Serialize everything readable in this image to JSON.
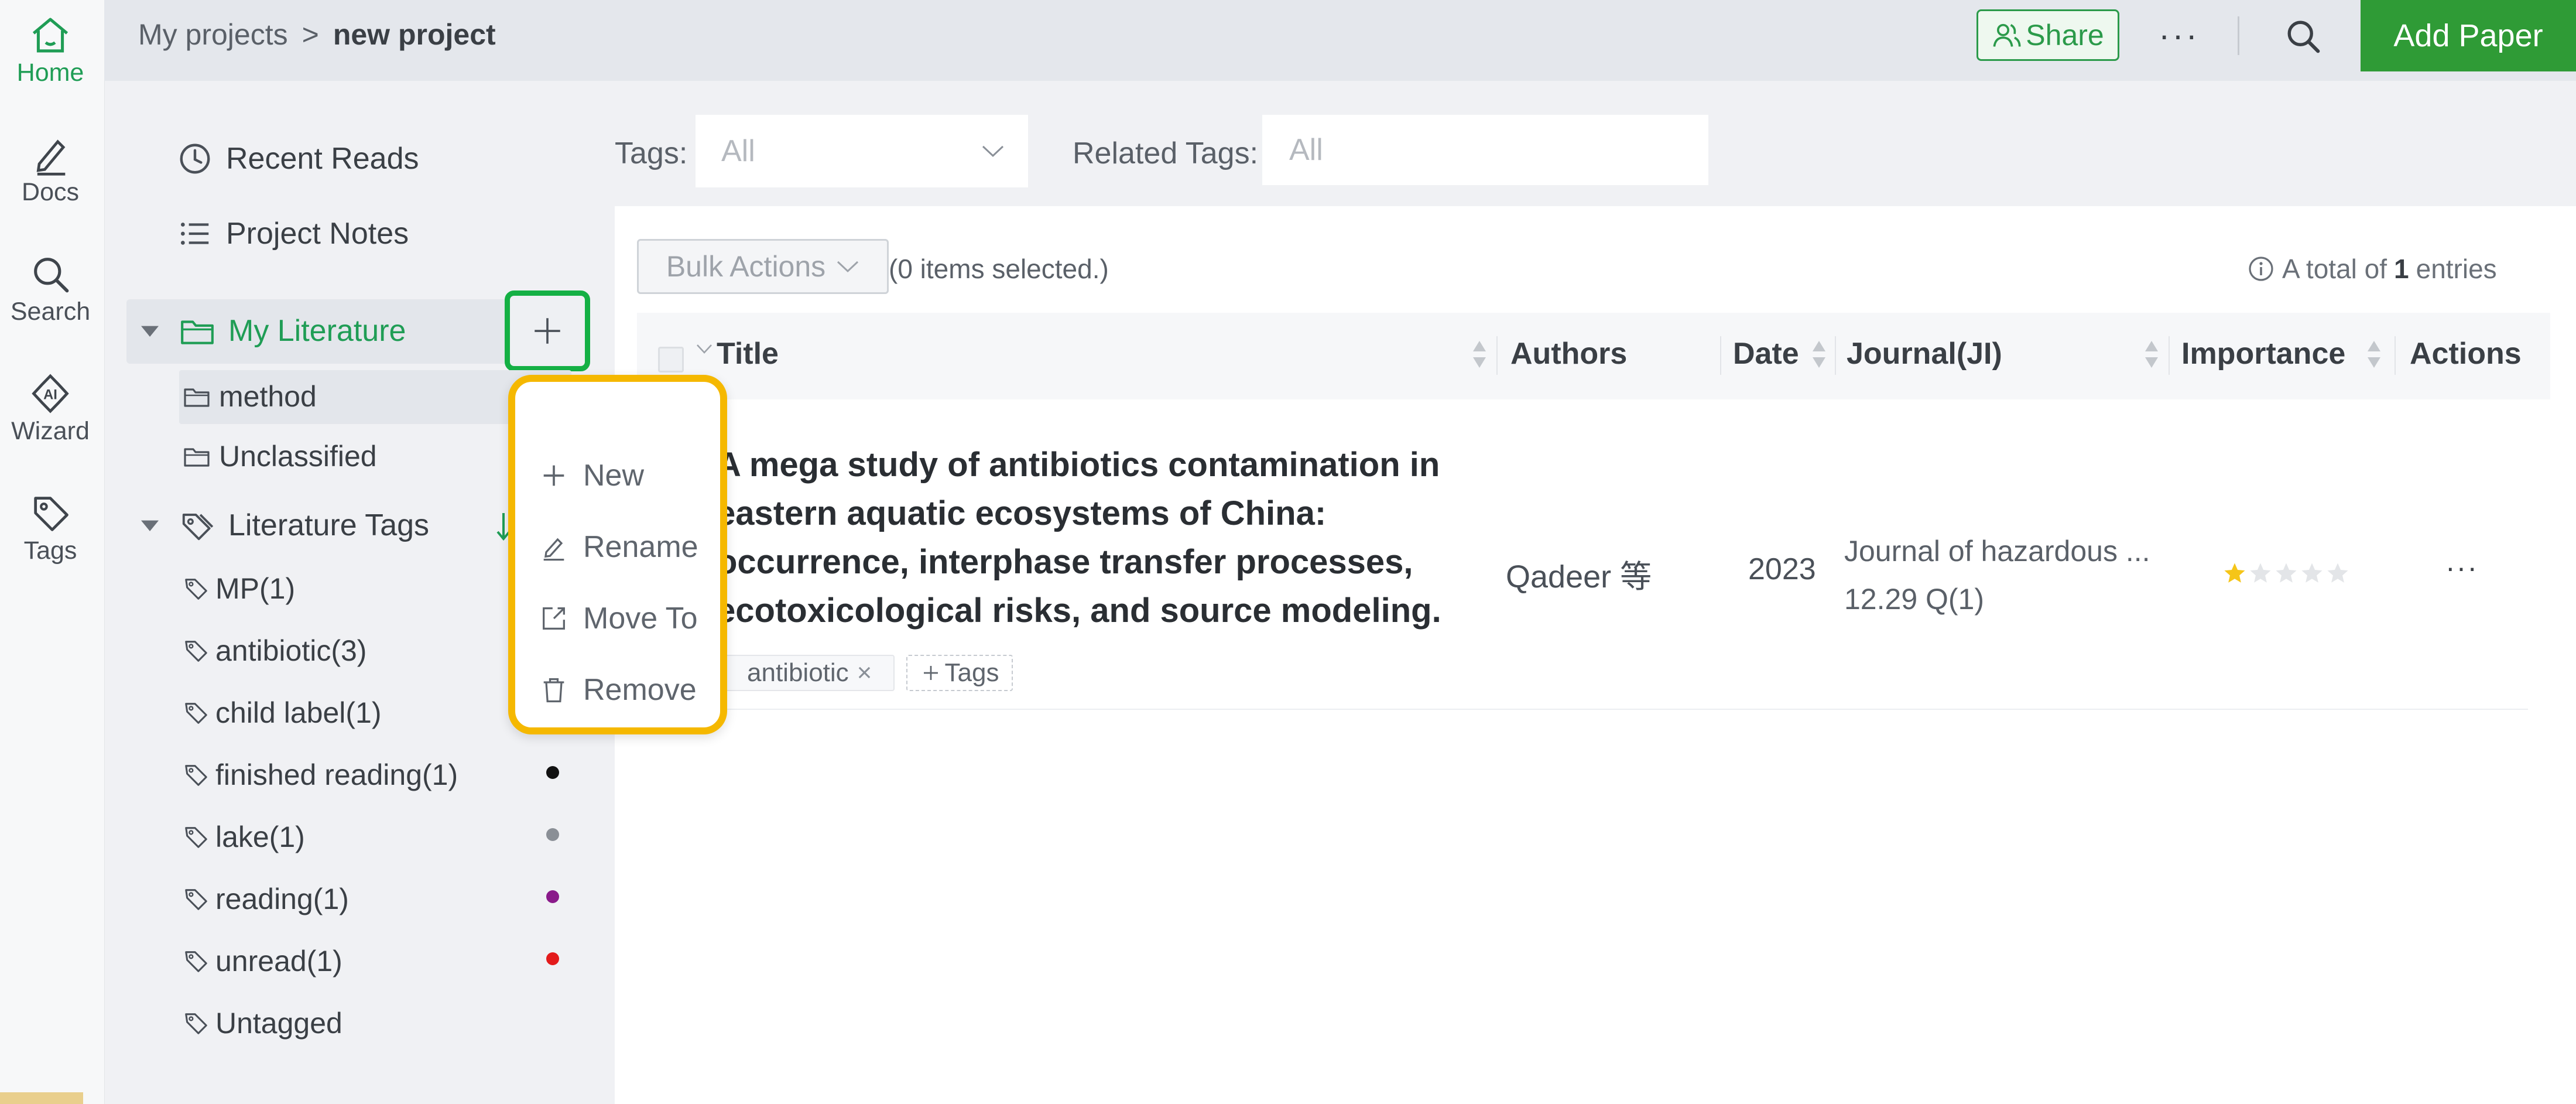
{
  "rail": {
    "items": [
      {
        "label": "Home",
        "icon": "home-icon",
        "active": true
      },
      {
        "label": "Docs",
        "icon": "pen-icon",
        "active": false
      },
      {
        "label": "Search",
        "icon": "search-icon",
        "active": false
      },
      {
        "label": "Wizard",
        "icon": "ai-wizard-icon",
        "active": false
      },
      {
        "label": "Tags",
        "icon": "tag-icon",
        "active": false
      }
    ]
  },
  "header": {
    "breadcrumb_root": "My projects",
    "breadcrumb_sep": ">",
    "breadcrumb_current": "new project",
    "share_label": "Share",
    "more_label": "···",
    "add_paper_label": "Add Paper"
  },
  "sidebar": {
    "recent_reads": "Recent Reads",
    "project_notes": "Project Notes",
    "my_literature": "My Literature",
    "folders": [
      "method",
      "Unclassified"
    ],
    "literature_tags": "Literature Tags",
    "tags": [
      {
        "label": "MP(1)",
        "color": ""
      },
      {
        "label": "antibiotic(3)",
        "color": ""
      },
      {
        "label": "child label(1)",
        "color": ""
      },
      {
        "label": "finished reading(1)",
        "color": "#111111"
      },
      {
        "label": "lake(1)",
        "color": "#8a8f96"
      },
      {
        "label": "reading(1)",
        "color": "#8a1a8a"
      },
      {
        "label": "unread(1)",
        "color": "#e31b1b"
      },
      {
        "label": "Untagged",
        "color": ""
      }
    ]
  },
  "context_menu": {
    "items": [
      {
        "label": "New",
        "icon": "plus-icon"
      },
      {
        "label": "Rename",
        "icon": "edit-icon"
      },
      {
        "label": "Move To",
        "icon": "move-icon"
      },
      {
        "label": "Remove",
        "icon": "trash-icon"
      }
    ]
  },
  "filters": {
    "tags_label": "Tags:",
    "tags_value": "All",
    "related_label": "Related Tags:",
    "related_placeholder": "All"
  },
  "toolbar": {
    "bulk_actions": "Bulk Actions",
    "selected_text": "(0 items selected.)",
    "total_prefix": "A total of",
    "total_count": "1",
    "total_suffix": "entries"
  },
  "table": {
    "columns": [
      "Title",
      "Authors",
      "Date",
      "Journal(JI)",
      "Importance",
      "Actions"
    ],
    "rows": [
      {
        "title_lines": [
          "A mega study of antibiotics contamination in",
          "eastern aquatic ecosystems of China:",
          "occurrence, interphase transfer processes,",
          "ecotoxicological risks, and source modeling."
        ],
        "tag": "antibiotic",
        "tag_remove": "×",
        "add_tags": "Tags",
        "authors": "Qadeer 等",
        "date": "2023",
        "journal": "Journal of hazardous ...",
        "journal_metric": "12.29 Q(1)",
        "importance": 1,
        "importance_max": 5,
        "actions": "···"
      }
    ]
  },
  "colors": {
    "accent_green": "#2f9b36",
    "highlight_green": "#14b044",
    "highlight_yellow": "#f5b800",
    "star": "#f5c518"
  }
}
